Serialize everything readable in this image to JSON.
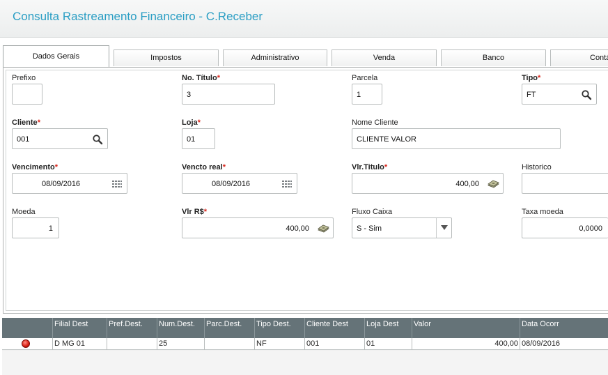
{
  "header": {
    "title": "Consulta Rastreamento Financeiro - C.Receber"
  },
  "tabs": [
    {
      "label": "Dados Gerais",
      "active": true
    },
    {
      "label": "Impostos"
    },
    {
      "label": "Administrativo"
    },
    {
      "label": "Venda"
    },
    {
      "label": "Banco"
    },
    {
      "label": "Contá"
    }
  ],
  "form": {
    "prefixo": {
      "label": "Prefixo",
      "value": ""
    },
    "no_titulo": {
      "label": "No. Título",
      "value": "3"
    },
    "parcela": {
      "label": "Parcela",
      "value": "1"
    },
    "tipo": {
      "label": "Tipo",
      "value": "FT"
    },
    "cliente": {
      "label": "Cliente",
      "value": "001"
    },
    "loja": {
      "label": "Loja",
      "value": "01"
    },
    "nome_cliente": {
      "label": "Nome Cliente",
      "value": "CLIENTE VALOR"
    },
    "vencimento": {
      "label": "Vencimento",
      "value": "08/09/2016"
    },
    "vencto_real": {
      "label": "Vencto real",
      "value": "08/09/2016"
    },
    "vlr_titulo": {
      "label": "Vlr.Titulo",
      "value": "400,00"
    },
    "historico": {
      "label": "Historico",
      "value": ""
    },
    "moeda": {
      "label": "Moeda",
      "value": "1"
    },
    "vlr_rs": {
      "label": "Vlr R$",
      "value": "400,00"
    },
    "fluxo_caixa": {
      "label": "Fluxo Caixa",
      "value": "S - Sim"
    },
    "taxa_moeda": {
      "label": "Taxa moeda",
      "value": "0,0000"
    },
    "required_mark": "*"
  },
  "grid": {
    "columns": [
      "Filial Dest",
      "Pref.Dest.",
      "Num.Dest.",
      "Parc.Dest.",
      "Tipo Dest.",
      "Cliente Dest",
      "Loja Dest",
      "Valor",
      "Data Ocorr"
    ],
    "rows": [
      [
        "D MG 01",
        "",
        "25",
        "",
        "NF",
        "001",
        "01",
        "400,00",
        "08/09/2016"
      ]
    ]
  },
  "icons": {
    "search": "magnifier-icon",
    "calendar": "calendar-icon",
    "money": "money-icon",
    "dropdown": "chevron-down-icon",
    "status": "red-status-icon"
  },
  "colors": {
    "title": "#2b9ec4",
    "grid_header": "#657378",
    "required": "#d9261c",
    "status": "#d81c10"
  }
}
